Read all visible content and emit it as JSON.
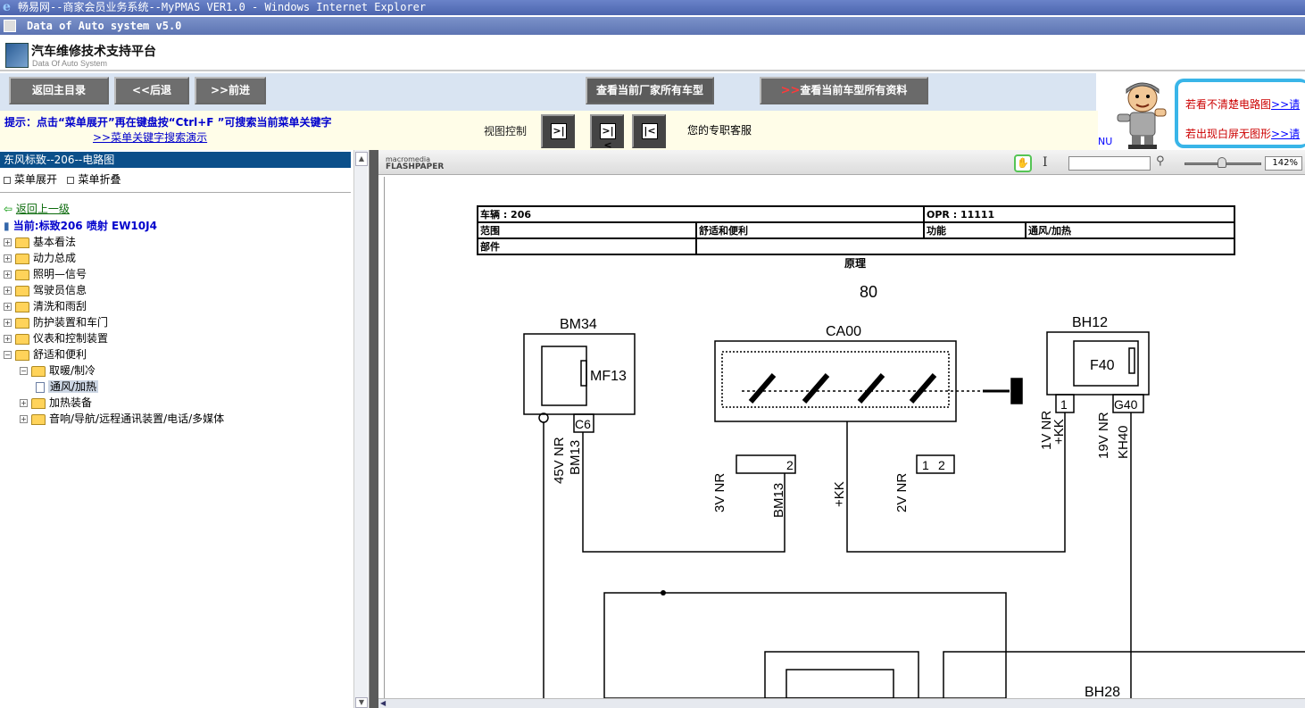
{
  "window": {
    "title": "畅易网--商家会员业务系统--MyPMAS VER1.0 - Windows Internet Explorer",
    "app_title": "Data of Auto system v5.0"
  },
  "brand": {
    "name": "汽车维修技术支持平台",
    "subtitle": "Data Of Auto System"
  },
  "nav": {
    "home": "返回主目录",
    "back": "<<后退",
    "forward": ">>前进",
    "all_models": "查看当前厂家所有车型",
    "all_docs": "查看当前车型所有资料",
    "all_docs_arrow": ">>"
  },
  "hint": {
    "line1": "提示：点击“菜单展开”再在键盘按“Ctrl+F ”可搜索当前菜单关键字",
    "line2": ">>菜单关键字搜索演示"
  },
  "view_control": {
    "label": "视图控制",
    "buttons": [
      ">|",
      ">|<",
      "|<"
    ]
  },
  "service": "您的专职客服",
  "right_panel": {
    "line1": "若看不清楚电路图",
    "line1_link": ">>请",
    "line2": "若出现白屏无图形",
    "line2_link": ">>请",
    "nu": "NU"
  },
  "sidebar": {
    "header": "东风标致--206--电路图",
    "expand": "菜单展开",
    "collapse": "菜单折叠",
    "back_up": "返回上一级",
    "current": "当前:标致206 喷射  EW10J4",
    "tree": [
      {
        "label": "基本看法",
        "level": 0,
        "state": "+"
      },
      {
        "label": "动力总成",
        "level": 0,
        "state": "+"
      },
      {
        "label": "照明—信号",
        "level": 0,
        "state": "+"
      },
      {
        "label": "驾驶员信息",
        "level": 0,
        "state": "+"
      },
      {
        "label": "清洗和雨刮",
        "level": 0,
        "state": "+"
      },
      {
        "label": "防护装置和车门",
        "level": 0,
        "state": "+"
      },
      {
        "label": "仪表和控制装置",
        "level": 0,
        "state": "+"
      },
      {
        "label": "舒适和便利",
        "level": 0,
        "state": "-"
      },
      {
        "label": "取暖/制冷",
        "level": 1,
        "state": "-"
      },
      {
        "label": "通风/加热",
        "level": 2,
        "state": "doc",
        "selected": true
      },
      {
        "label": "加热装备",
        "level": 1,
        "state": "+"
      },
      {
        "label": "音响/导航/远程通讯装置/电话/多媒体",
        "level": 1,
        "state": "+"
      }
    ]
  },
  "viewer": {
    "brand_small": "macromedia",
    "brand_big": "FLASHPAPER",
    "zoom": "142%",
    "search_value": "",
    "doc": {
      "vehicle": "车辆 : 206",
      "opr": "OPR : 11111",
      "scope_label": "范围",
      "scope_value": "舒适和便利",
      "function_label": "功能",
      "function_value": "通风/加热",
      "part_label": "部件",
      "principle": "原理",
      "page_num": "80",
      "comp_bm34": "BM34",
      "comp_ca00": "CA00",
      "comp_bh12": "BH12",
      "comp_bh28": "BH28",
      "mf13": "MF13",
      "f40": "F40",
      "c6": "C6",
      "g40": "G40",
      "w_45v": "45V NR",
      "w_bm13a": "BM13",
      "w_3v": "3V NR",
      "w_bm13b": "BM13",
      "w_kk": "+KK",
      "w_2v": "2V NR",
      "w_1v": "1V NR",
      "w_kk2": "+KK",
      "w_19v": "19V NR",
      "w_kh40": "KH40",
      "pin1": "1",
      "pin2": "2"
    }
  }
}
